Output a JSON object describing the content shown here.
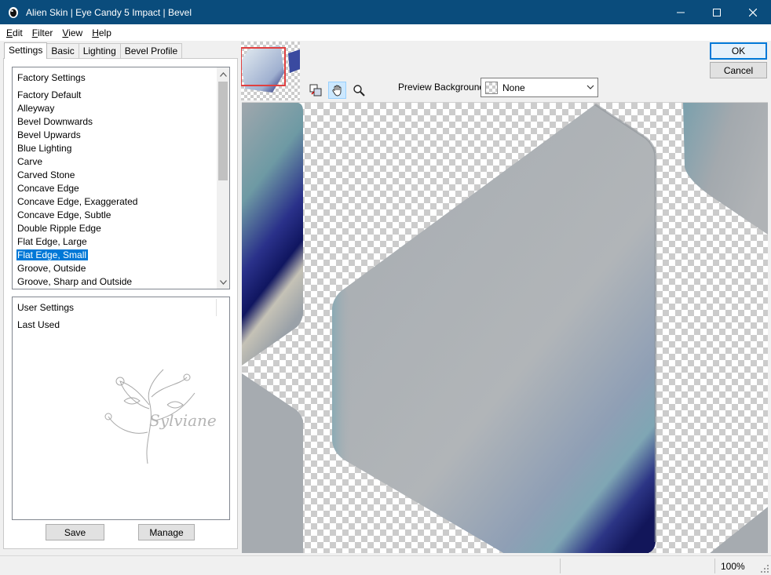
{
  "window": {
    "title": "Alien Skin | Eye Candy 5 Impact | Bevel",
    "titlebar_color": "#0a4c7c"
  },
  "menu": [
    {
      "label_ul": "E",
      "label_rest": "dit"
    },
    {
      "label_ul": "F",
      "label_rest": "ilter"
    },
    {
      "label_ul": "V",
      "label_rest": "iew"
    },
    {
      "label_ul": "H",
      "label_rest": "elp"
    }
  ],
  "tabs": [
    "Settings",
    "Basic",
    "Lighting",
    "Bevel Profile"
  ],
  "factory_settings": {
    "header": "Factory Settings",
    "items": [
      "Factory Default",
      "Alleyway",
      "Bevel Downwards",
      "Bevel Upwards",
      "Blue Lighting",
      "Carve",
      "Carved Stone",
      "Concave Edge",
      "Concave Edge, Exaggerated",
      "Concave Edge, Subtle",
      "Double Ripple Edge",
      "Flat Edge, Large",
      "Flat Edge, Small",
      "Groove, Outside",
      "Groove, Sharp and Outside"
    ],
    "selected": "Flat Edge, Small"
  },
  "user_settings": {
    "header": "User Settings",
    "items": [
      "Last Used"
    ],
    "watermark": "Sylviane"
  },
  "buttons": {
    "save": "Save",
    "manage": "Manage",
    "ok": "OK",
    "cancel": "Cancel"
  },
  "preview_background": {
    "label": "Preview Background:",
    "value": "None"
  },
  "tools": [
    "preview-compare-icon",
    "hand-pan-icon",
    "zoom-magnifier-icon"
  ],
  "status": {
    "zoom": "100%"
  },
  "colors": {
    "selection": "#0078d7",
    "default_button_border": "#0078d7",
    "accent_navy": "#1a1f6e"
  }
}
